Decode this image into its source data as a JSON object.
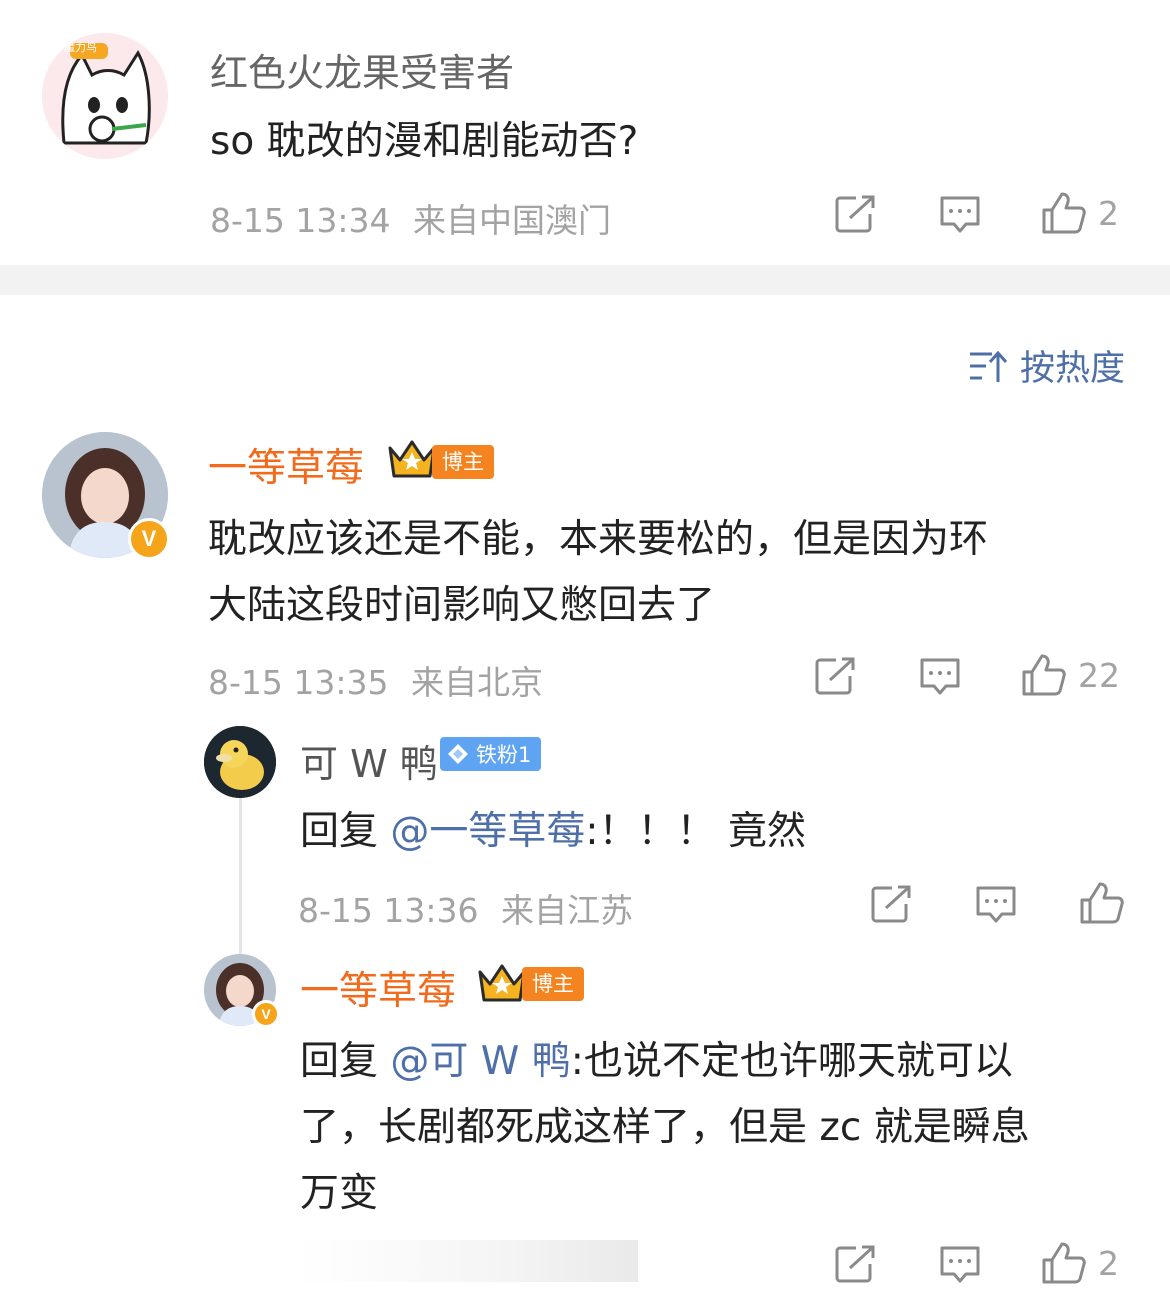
{
  "comment1": {
    "avatar_label": "魔力鸟",
    "username": "红色火龙果受害者",
    "text": "so 耽改的漫和剧能动否?",
    "time": "8-15 13:34",
    "location": "来自中国澳门",
    "likes": "2"
  },
  "sort": {
    "label": "按热度"
  },
  "comment2": {
    "username": "一等草莓",
    "badge": "博主",
    "verified_mark": "V",
    "text_line1": "耽改应该还是不能，本来要松的，但是因为环",
    "text_line2": "大陆这段时间影响又憋回去了",
    "time": "8-15 13:35",
    "location": "来自北京",
    "likes": "22"
  },
  "reply1": {
    "username": "可 W 鸭",
    "badge": "铁粉1",
    "reply_prefix": "回复 ",
    "mention": "@一等草莓",
    "text": ":！！！ 竟然",
    "time": "8-15 13:36",
    "location": "来自江苏"
  },
  "reply2": {
    "username": "一等草莓",
    "badge": "博主",
    "verified_mark": "V",
    "reply_prefix": "回复 ",
    "mention": "@可 W 鸭",
    "text_line1": ":也说不定也许哪天就可以",
    "text_line2": "了，长剧都死成这样了，但是 zc 就是瞬息",
    "text_line3": "万变",
    "likes": "2"
  },
  "colors": {
    "vip_name": "#f26b1d",
    "mention": "#4f6fa8",
    "meta_gray": "#a3a3a3",
    "badge_orange": "#f5831f",
    "badge_blue": "#5fa4f2",
    "divider": "#f2f2f2"
  },
  "icons": [
    "share-icon",
    "comment-icon",
    "like-icon",
    "sort-icon",
    "crown-icon",
    "diamond-icon"
  ]
}
